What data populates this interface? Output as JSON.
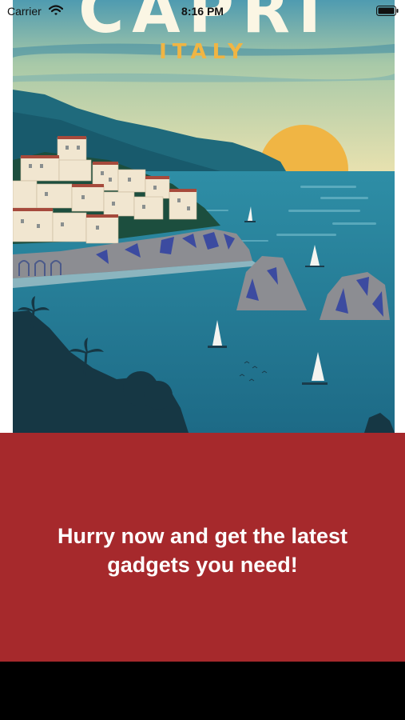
{
  "status_bar": {
    "carrier": "Carrier",
    "time": "8:16 PM",
    "wifi_icon": "wifi-icon",
    "battery_icon": "battery-full-icon"
  },
  "poster": {
    "title": "CAPRI",
    "subtitle": "ITALY"
  },
  "promo": {
    "text": "Hurry now and get the latest gadgets you need!",
    "background_color": "#a6292c",
    "text_color": "#ffffff"
  }
}
